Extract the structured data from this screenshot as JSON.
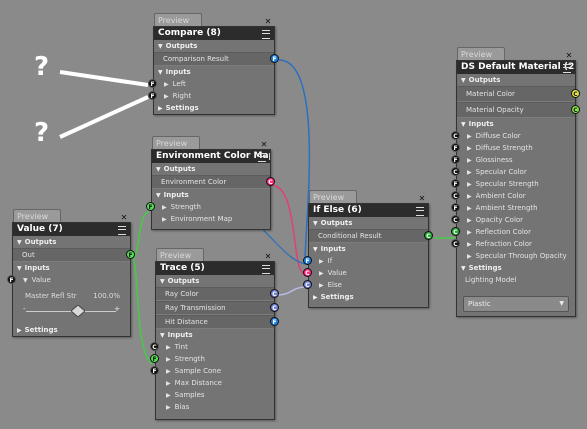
{
  "annotations": {
    "q1": "?",
    "q2": "?"
  },
  "compare": {
    "tab": "Preview",
    "title": "Compare (8)",
    "outputs": "Outputs",
    "out1": "Comparison Result",
    "inputs": "Inputs",
    "in1": "Left",
    "in2": "Right",
    "settings": "Settings"
  },
  "envmap": {
    "tab": "Preview",
    "title": "Environment Color Map (",
    "outputs": "Outputs",
    "out1": "Environment Color",
    "inputs": "Inputs",
    "in1": "Strength",
    "in2": "Environment Map"
  },
  "value": {
    "tab": "Preview",
    "title": "Value (7)",
    "outputs": "Outputs",
    "out1": "Out",
    "inputs": "Inputs",
    "in1": "Value",
    "slider_label": "Master Refl Str",
    "slider_value": "100.0%",
    "slider_min": "-",
    "slider_max": "+",
    "settings": "Settings"
  },
  "trace": {
    "tab": "Preview",
    "title": "Trace (5)",
    "outputs": "Outputs",
    "out1": "Ray Color",
    "out2": "Ray Transmission",
    "out3": "Hit Distance",
    "inputs": "Inputs",
    "in": [
      "Tint",
      "Strength",
      "Sample Cone",
      "Max Distance",
      "Samples",
      "Bias"
    ]
  },
  "ifelse": {
    "tab": "Preview",
    "title": "If Else (6)",
    "outputs": "Outputs",
    "out1": "Conditional Result",
    "inputs": "Inputs",
    "in1": "If",
    "in2": "Value",
    "in3": "Else",
    "settings": "Settings"
  },
  "material": {
    "tab": "Preview",
    "title": "DS Default Material (2)",
    "outputs": "Outputs",
    "out1": "Material Color",
    "out2": "Material Opacity",
    "inputs": "Inputs",
    "in": [
      "Diffuse Color",
      "Diffuse Strength",
      "Glossiness",
      "Specular Color",
      "Specular Strength",
      "Ambient Color",
      "Ambient Strength",
      "Opacity Color",
      "Reflection Color",
      "Refraction Color",
      "Specular Through Opacity"
    ],
    "settings": "Settings",
    "lighting_label": "Lighting Model",
    "lighting_value": "Plastic"
  },
  "port_letters": {
    "float": "F",
    "color": "C"
  },
  "colors": {
    "float_port": "#1f7fe0",
    "color_port": "#6f7fd0",
    "link_blue": "#2a6fc0",
    "link_pink": "#e0407a",
    "link_green": "#44cc44",
    "link_lavender": "#b8bce8"
  }
}
